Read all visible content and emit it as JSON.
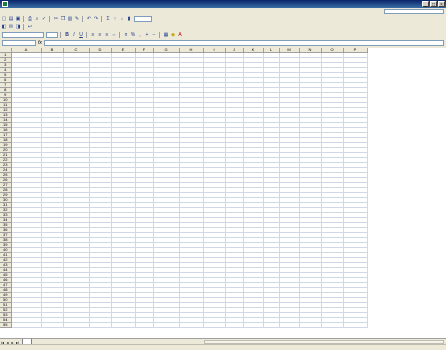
{
  "window": {
    "title": ""
  },
  "menu": {
    "items": [],
    "help_placeholder": ""
  },
  "toolbar": {
    "font_name": "",
    "font_size": "",
    "zoom": ""
  },
  "formula_bar": {
    "name_box": "",
    "fx_label": "fx",
    "formula": ""
  },
  "grid": {
    "columns": [
      "A",
      "B",
      "C",
      "D",
      "E",
      "F",
      "G",
      "H",
      "I",
      "J",
      "K",
      "L",
      "M",
      "N",
      "O",
      "P"
    ],
    "rows": [
      "1",
      "2",
      "3",
      "4",
      "5",
      "6",
      "7",
      "8",
      "9",
      "10",
      "11",
      "12",
      "13",
      "14",
      "15",
      "16",
      "17",
      "18",
      "19",
      "20",
      "21",
      "22",
      "23",
      "24",
      "25",
      "26",
      "27",
      "28",
      "29",
      "30",
      "31",
      "32",
      "33",
      "34",
      "35",
      "36",
      "37",
      "38",
      "39",
      "40",
      "41",
      "42",
      "43",
      "44",
      "45",
      "46",
      "47",
      "48",
      "49",
      "50",
      "51",
      "52",
      "53",
      "54",
      "55"
    ]
  },
  "sheets": {
    "active": ""
  },
  "status": {
    "text": ""
  },
  "colors": {
    "titlebar": "#0a246a",
    "chrome": "#ece9d8",
    "gridline": "#d0d7e5"
  }
}
